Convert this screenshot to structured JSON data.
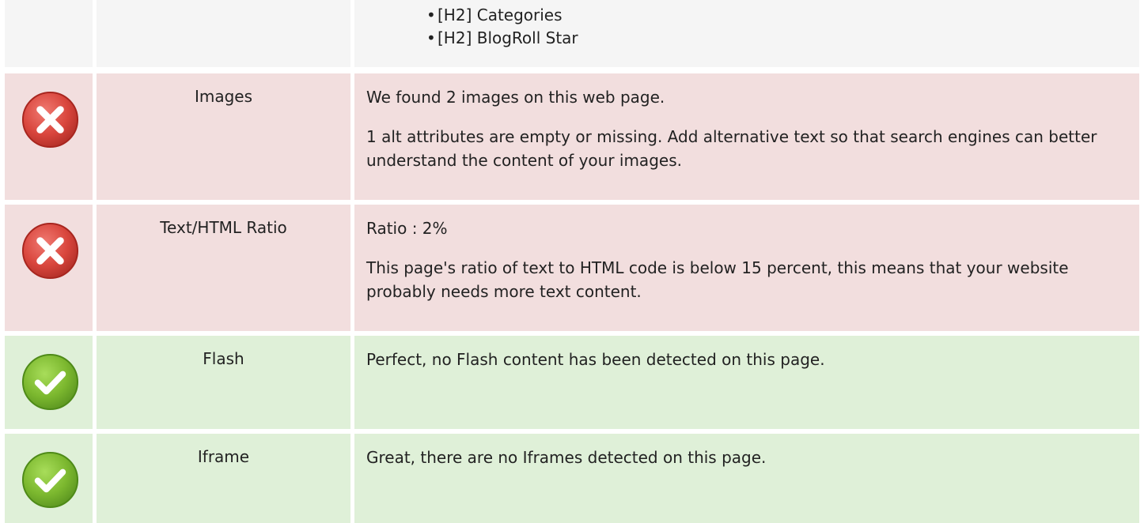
{
  "headings_section": {
    "items": [
      "[H2] Categories",
      "[H2] BlogRoll Star"
    ]
  },
  "checks": [
    {
      "status": "error",
      "status_icon": "error-x-icon",
      "label": "Images",
      "line1": "We found 2 images on this web page.",
      "detail": "1 alt attributes are empty or missing. Add alternative text so that search engines can better understand the content of your images."
    },
    {
      "status": "error",
      "status_icon": "error-x-icon",
      "label": "Text/HTML Ratio",
      "line1": "Ratio : 2%",
      "detail": "This page's ratio of text to HTML code is below 15 percent, this means that your website probably needs more text content."
    },
    {
      "status": "success",
      "status_icon": "success-check-icon",
      "label": "Flash",
      "line1": "Perfect, no Flash content has been detected on this page."
    },
    {
      "status": "success",
      "status_icon": "success-check-icon",
      "label": "Iframe",
      "line1": "Great, there are no Iframes detected on this page."
    }
  ],
  "colors": {
    "neutral_bg": "#f5f5f5",
    "error_bg": "#f2dede",
    "success_bg": "#dff0d8",
    "error_icon": "#d9534f",
    "success_icon": "#7cb82f"
  }
}
